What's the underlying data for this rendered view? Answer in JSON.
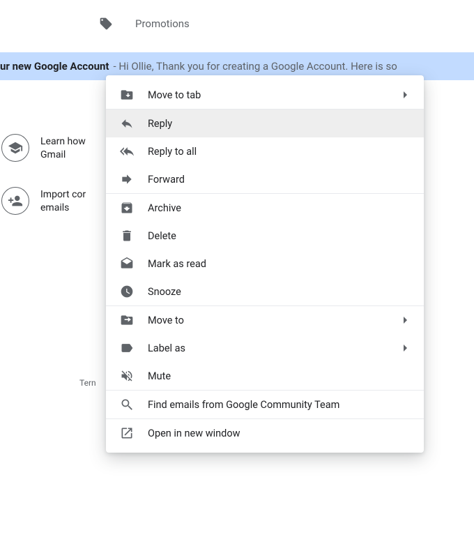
{
  "tabs": {
    "promotions": "Promotions"
  },
  "email": {
    "subject_visible": "ur new Google Account",
    "snippet": "- Hi Ollie, Thank you for creating a Google Account. Here is so"
  },
  "side": {
    "learn": "Learn how\nGmail",
    "import": "Import cor\nemails"
  },
  "footer": {
    "terms": "Tern"
  },
  "menu": {
    "move_to_tab": "Move to tab",
    "reply": "Reply",
    "reply_all": "Reply to all",
    "forward": "Forward",
    "archive": "Archive",
    "delete": "Delete",
    "mark_as_read": "Mark as read",
    "snooze": "Snooze",
    "move_to": "Move to",
    "label_as": "Label as",
    "mute": "Mute",
    "find_emails": "Find emails from Google Community Team",
    "open_new_window": "Open in new window"
  }
}
